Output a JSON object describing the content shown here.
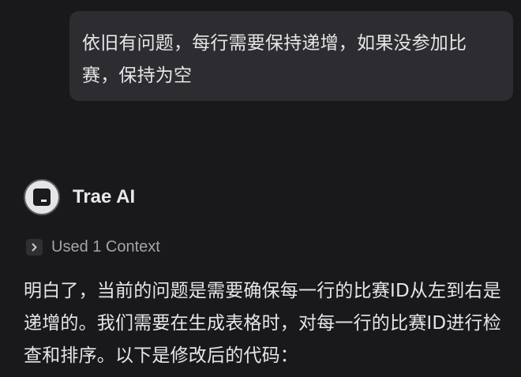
{
  "user_message": {
    "text": "依旧有问题，每行需要保持递增，如果没参加比赛，保持为空"
  },
  "ai_header": {
    "name": "Trae AI",
    "avatar_icon": "trae-logo-icon"
  },
  "context": {
    "label": "Used 1 Context",
    "icon": "chevron-right-icon"
  },
  "ai_message": {
    "text": "明白了，当前的问题是需要确保每一行的比赛ID从左到右是递增的。我们需要在生成表格时，对每一行的比赛ID进行检查和排序。以下是修改后的代码："
  },
  "colors": {
    "background": "#19191b",
    "bubble": "#2d2d31",
    "text": "#e6e6e9",
    "muted": "#a4a4aa"
  }
}
